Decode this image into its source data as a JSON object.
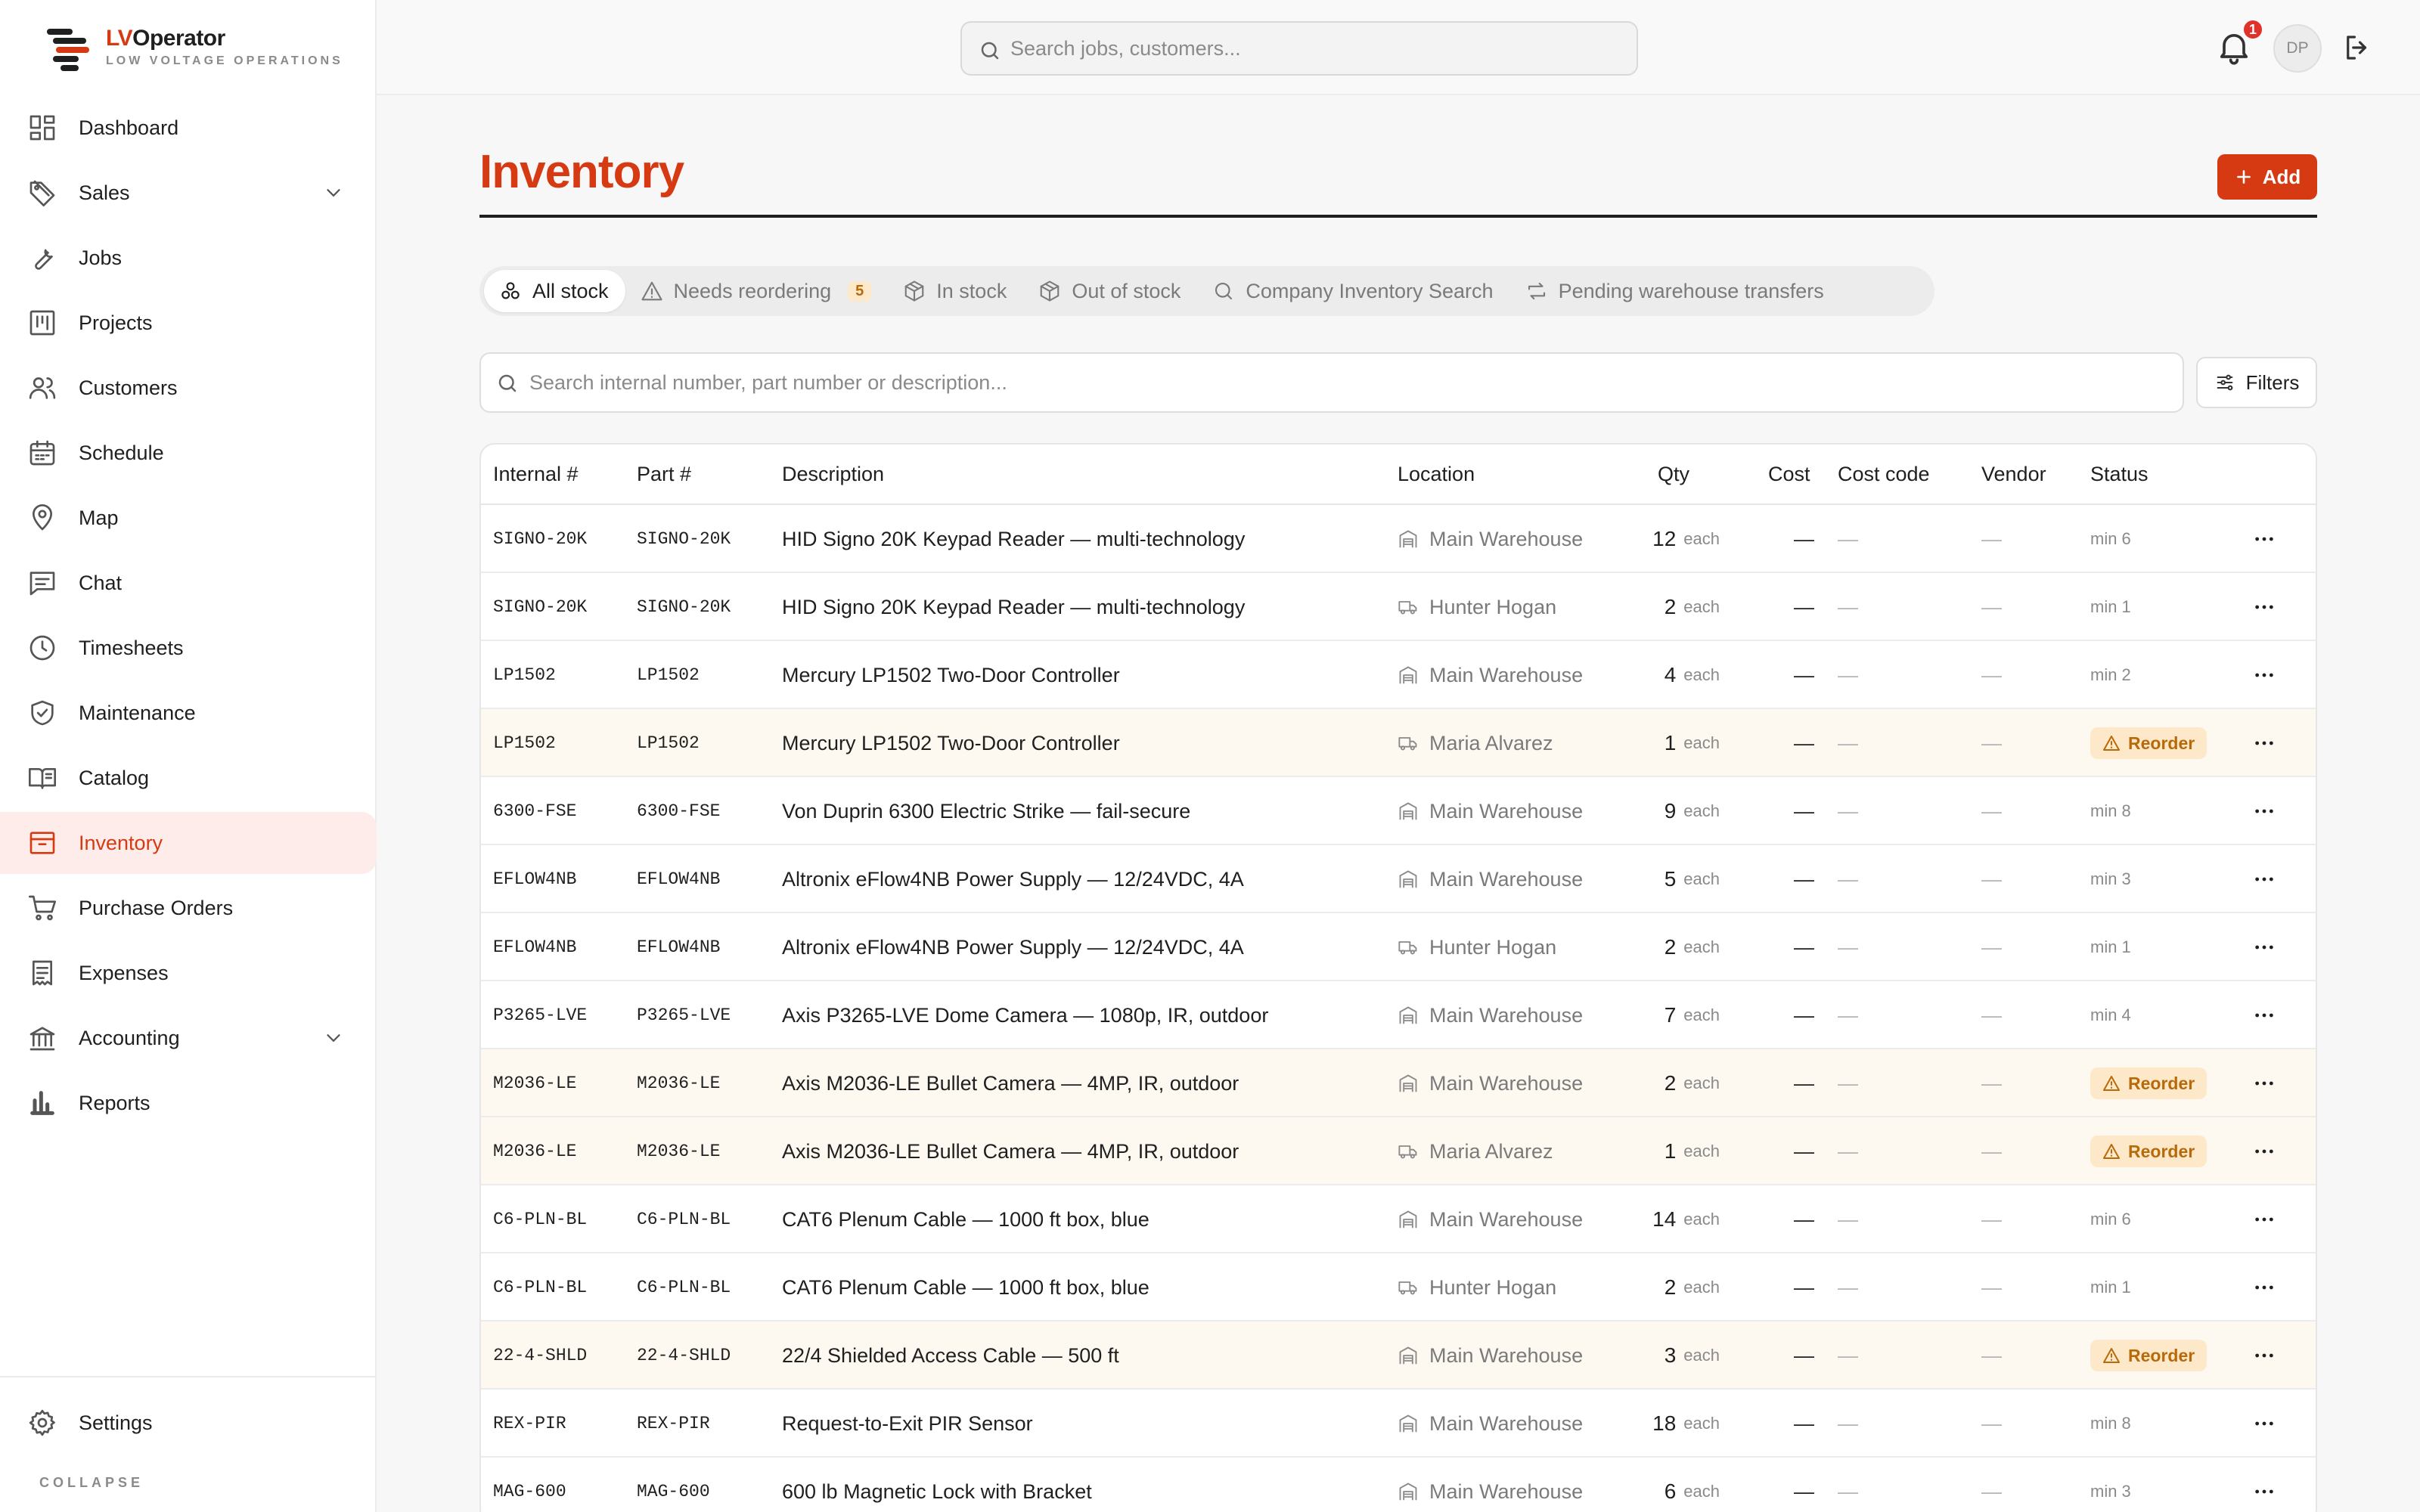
{
  "brand": {
    "lv": "LV",
    "op": "Operator",
    "subtitle": "LOW VOLTAGE OPERATIONS"
  },
  "nav": [
    {
      "label": "Dashboard",
      "icon": "dashboard-icon"
    },
    {
      "label": "Sales",
      "icon": "tag-icon",
      "expandable": true
    },
    {
      "label": "Jobs",
      "icon": "wrench-icon"
    },
    {
      "label": "Projects",
      "icon": "kanban-icon"
    },
    {
      "label": "Customers",
      "icon": "users-icon"
    },
    {
      "label": "Schedule",
      "icon": "calendar-icon"
    },
    {
      "label": "Map",
      "icon": "map-pin-icon"
    },
    {
      "label": "Chat",
      "icon": "chat-icon"
    },
    {
      "label": "Timesheets",
      "icon": "clock-icon"
    },
    {
      "label": "Maintenance",
      "icon": "shield-icon"
    },
    {
      "label": "Catalog",
      "icon": "book-icon"
    },
    {
      "label": "Inventory",
      "icon": "archive-icon",
      "active": true
    },
    {
      "label": "Purchase Orders",
      "icon": "cart-icon"
    },
    {
      "label": "Expenses",
      "icon": "receipt-icon"
    },
    {
      "label": "Accounting",
      "icon": "bank-icon",
      "expandable": true
    },
    {
      "label": "Reports",
      "icon": "bar-chart-icon"
    }
  ],
  "settings_label": "Settings",
  "collapse_label": "COLLAPSE",
  "topbar": {
    "search_placeholder": "Search jobs, customers...",
    "notification_count": "1",
    "avatar_initials": "DP"
  },
  "page": {
    "title": "Inventory",
    "add_label": "Add",
    "search_placeholder": "Search internal number, part number or description...",
    "filters_label": "Filters"
  },
  "tabs": [
    {
      "label": "All stock",
      "icon": "all-stock-icon",
      "active": true
    },
    {
      "label": "Needs reordering",
      "icon": "warning-icon",
      "count": "5"
    },
    {
      "label": "In stock",
      "icon": "box-icon"
    },
    {
      "label": "Out of stock",
      "icon": "box-icon"
    },
    {
      "label": "Company Inventory Search",
      "icon": "search-icon"
    },
    {
      "label": "Pending warehouse transfers",
      "icon": "transfer-icon"
    }
  ],
  "columns": {
    "internal": "Internal #",
    "part": "Part #",
    "description": "Description",
    "location": "Location",
    "qty": "Qty",
    "cost": "Cost",
    "cost_code": "Cost code",
    "vendor": "Vendor",
    "status": "Status"
  },
  "unit_label": "each",
  "reorder_label": "Reorder",
  "dash": "—",
  "rows": [
    {
      "internal": "SIGNO-20K",
      "part": "SIGNO-20K",
      "description": "HID Signo 20K Keypad Reader — multi-technology",
      "location": "Main Warehouse",
      "loc_type": "warehouse",
      "qty": "12",
      "status": "min 6"
    },
    {
      "internal": "SIGNO-20K",
      "part": "SIGNO-20K",
      "description": "HID Signo 20K Keypad Reader — multi-technology",
      "location": "Hunter Hogan",
      "loc_type": "truck",
      "qty": "2",
      "status": "min 1"
    },
    {
      "internal": "LP1502",
      "part": "LP1502",
      "description": "Mercury LP1502 Two-Door Controller",
      "location": "Main Warehouse",
      "loc_type": "warehouse",
      "qty": "4",
      "status": "min 2"
    },
    {
      "internal": "LP1502",
      "part": "LP1502",
      "description": "Mercury LP1502 Two-Door Controller",
      "location": "Maria Alvarez",
      "loc_type": "truck",
      "qty": "1",
      "status": "Reorder",
      "reorder": true
    },
    {
      "internal": "6300-FSE",
      "part": "6300-FSE",
      "description": "Von Duprin 6300 Electric Strike — fail-secure",
      "location": "Main Warehouse",
      "loc_type": "warehouse",
      "qty": "9",
      "status": "min 8"
    },
    {
      "internal": "EFLOW4NB",
      "part": "EFLOW4NB",
      "description": "Altronix eFlow4NB Power Supply — 12/24VDC, 4A",
      "location": "Main Warehouse",
      "loc_type": "warehouse",
      "qty": "5",
      "status": "min 3"
    },
    {
      "internal": "EFLOW4NB",
      "part": "EFLOW4NB",
      "description": "Altronix eFlow4NB Power Supply — 12/24VDC, 4A",
      "location": "Hunter Hogan",
      "loc_type": "truck",
      "qty": "2",
      "status": "min 1"
    },
    {
      "internal": "P3265-LVE",
      "part": "P3265-LVE",
      "description": "Axis P3265-LVE Dome Camera — 1080p, IR, outdoor",
      "location": "Main Warehouse",
      "loc_type": "warehouse",
      "qty": "7",
      "status": "min 4"
    },
    {
      "internal": "M2036-LE",
      "part": "M2036-LE",
      "description": "Axis M2036-LE Bullet Camera — 4MP, IR, outdoor",
      "location": "Main Warehouse",
      "loc_type": "warehouse",
      "qty": "2",
      "status": "Reorder",
      "reorder": true
    },
    {
      "internal": "M2036-LE",
      "part": "M2036-LE",
      "description": "Axis M2036-LE Bullet Camera — 4MP, IR, outdoor",
      "location": "Maria Alvarez",
      "loc_type": "truck",
      "qty": "1",
      "status": "Reorder",
      "reorder": true
    },
    {
      "internal": "C6-PLN-BL",
      "part": "C6-PLN-BL",
      "description": "CAT6 Plenum Cable — 1000 ft box, blue",
      "location": "Main Warehouse",
      "loc_type": "warehouse",
      "qty": "14",
      "status": "min 6"
    },
    {
      "internal": "C6-PLN-BL",
      "part": "C6-PLN-BL",
      "description": "CAT6 Plenum Cable — 1000 ft box, blue",
      "location": "Hunter Hogan",
      "loc_type": "truck",
      "qty": "2",
      "status": "min 1"
    },
    {
      "internal": "22-4-SHLD",
      "part": "22-4-SHLD",
      "description": "22/4 Shielded Access Cable — 500 ft",
      "location": "Main Warehouse",
      "loc_type": "warehouse",
      "qty": "3",
      "status": "Reorder",
      "reorder": true
    },
    {
      "internal": "REX-PIR",
      "part": "REX-PIR",
      "description": "Request-to-Exit PIR Sensor",
      "location": "Main Warehouse",
      "loc_type": "warehouse",
      "qty": "18",
      "status": "min 8"
    },
    {
      "internal": "MAG-600",
      "part": "MAG-600",
      "description": "600 lb Magnetic Lock with Bracket",
      "location": "Main Warehouse",
      "loc_type": "warehouse",
      "qty": "6",
      "status": "min 3"
    }
  ],
  "colors": {
    "accent": "#d63a12",
    "warn_bg": "#fde9c9",
    "warn_text": "#b86a0a",
    "row_warn": "#fdf9f1"
  }
}
